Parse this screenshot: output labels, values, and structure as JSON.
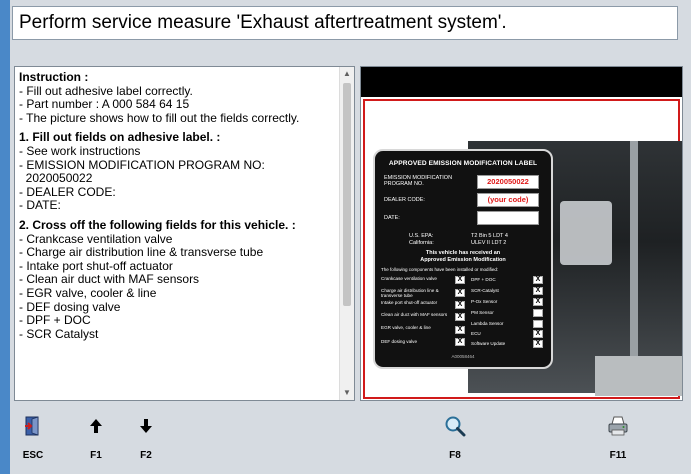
{
  "title": "Perform service measure 'Exhaust aftertreatment system'.",
  "instruction": {
    "heading": "Instruction :",
    "lines": [
      "- Fill out adhesive label correctly.",
      "- Part number : A 000 584 64 15",
      "- The picture shows how to fill out the fields correctly."
    ],
    "section1": {
      "heading": "1. Fill out fields on adhesive label. :",
      "lines": [
        "- See work instructions",
        "- EMISSION MODIFICATION PROGRAM NO:",
        "  2020050022",
        "- DEALER CODE:",
        "- DATE:"
      ]
    },
    "section2": {
      "heading": "2. Cross off the following fields for this vehicle. :",
      "lines": [
        "- Crankcase ventilation valve",
        "- Charge air distribution line & transverse tube",
        "- Intake port shut-off actuator",
        "- Clean air duct with MAF sensors",
        "- EGR valve, cooler & line",
        "- DEF dosing valve",
        "- DPF + DOC",
        "- SCR Catalyst"
      ]
    }
  },
  "label_image": {
    "title": "APPROVED EMISSION MODIFICATION LABEL",
    "program_label": "EMISSION MODIFICATION\nPROGRAM NO.",
    "program_value": "2020050022",
    "dealer_label": "DEALER CODE:",
    "dealer_value": "(your code)",
    "date_label": "DATE:",
    "epa_label": "U.S. EPA:",
    "epa_value": "T2 Bin 5 LDT 4",
    "california_label": "California:",
    "california_value": "ULEV II LDT 2",
    "notice_line1": "This vehicle has received an",
    "notice_line2": "Approved Emission Modification",
    "components_intro": "The following components have been installed or modified:",
    "left_components": [
      "Crankcase ventilation valve",
      "Charge air distribution line & transverse tube",
      "Intake port shut-off actuator",
      "Clean air duct with MAF sensors",
      "EGR valve, cooler & line",
      "DEF dosing valve"
    ],
    "right_components": [
      "DPF + DOC",
      "SCR-Catalyst",
      "P-Ox Sensor",
      "PM Sensor",
      "Lambda Sensor",
      "ECU",
      "Software Update"
    ],
    "footer": "A00058464"
  },
  "function_keys": [
    {
      "key": "ESC",
      "icon": "exit-door-icon"
    },
    {
      "key": "F1",
      "icon": "arrow-up-icon"
    },
    {
      "key": "F2",
      "icon": "arrow-down-icon"
    },
    {
      "key": "F8",
      "icon": "magnifier-icon"
    },
    {
      "key": "F11",
      "icon": "printer-icon"
    }
  ],
  "colors": {
    "background": "#d6dbe1",
    "label_highlight": "#e01818",
    "frame_red": "#d11a1a",
    "accent_blue": "#4a88c8"
  }
}
